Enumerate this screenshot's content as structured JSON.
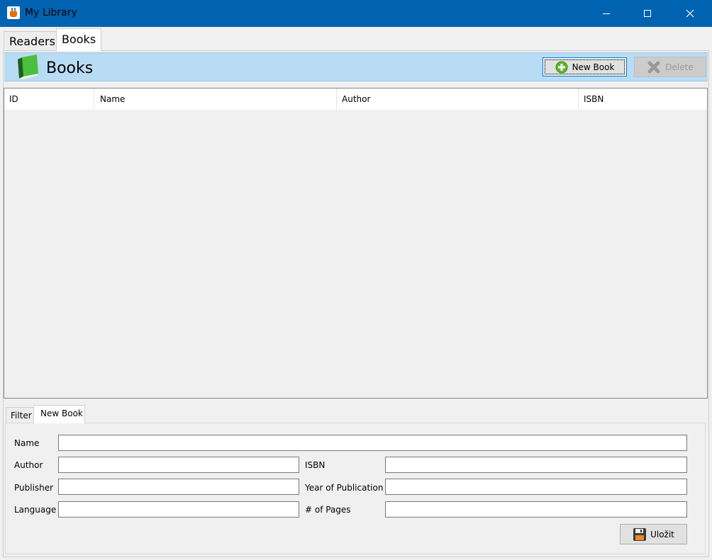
{
  "window": {
    "title": "My Library"
  },
  "tabs": [
    {
      "label": "Readers"
    },
    {
      "label": "Books"
    }
  ],
  "header": {
    "title": "Books",
    "new_book_label": "New Book",
    "delete_label": "Delete"
  },
  "table": {
    "columns": [
      "ID",
      "Name",
      "Author",
      "ISBN"
    ],
    "rows": []
  },
  "form_tabs": [
    {
      "label": "Filter"
    },
    {
      "label": "New Book"
    }
  ],
  "form": {
    "name_label": "Name",
    "name_value": "",
    "author_label": "Author",
    "author_value": "",
    "isbn_label": "ISBN",
    "isbn_value": "",
    "publisher_label": "Publisher",
    "publisher_value": "",
    "year_label": "Year of Publication",
    "year_value": "",
    "language_label": "Language",
    "language_value": "",
    "pages_label": "# of Pages",
    "pages_value": "",
    "save_label": "Uložit"
  },
  "colors": {
    "titlebar": "#0063b1",
    "header_band": "#b8dcf3",
    "add_icon": "#5cb82a",
    "book_icon": "#3aa33a"
  },
  "icons": [
    "java-app-icon",
    "minimize-icon",
    "maximize-icon",
    "close-icon",
    "book-icon",
    "add-icon",
    "delete-x-icon",
    "save-disk-icon"
  ]
}
